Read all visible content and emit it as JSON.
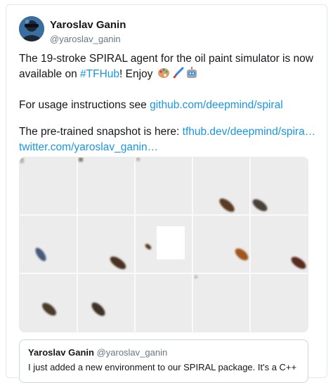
{
  "author": {
    "name": "Yaroslav Ganin",
    "handle": "@yaroslav_ganin"
  },
  "tweet": {
    "line1": "The 19-stroke SPIRAL agent for the oil paint simulator is now",
    "line2_prefix": "available on ",
    "hashtag": "#TFHub",
    "line2_suffix": "! Enjoy",
    "emojis": [
      "artist-palette",
      "paintbrush",
      "robot"
    ],
    "usage_prefix": "For usage instructions see ",
    "usage_link": "github.com/deepmind/spiral",
    "snapshot_prefix": "The pre-trained snapshot is here: ",
    "snapshot_link": "tfhub.dev/deepmind/spira…",
    "twitter_link": "twitter.com/yaroslav_ganin…"
  },
  "quoted_tweet": {
    "name": "Yaroslav Ganin",
    "handle": "@yaroslav_ganin",
    "text": "I just added a new environment to our SPIRAL package. It's a C++"
  },
  "colors": {
    "link": "#1b95e0",
    "text": "#14171a",
    "secondary": "#657786",
    "border": "#e1e8ed"
  }
}
